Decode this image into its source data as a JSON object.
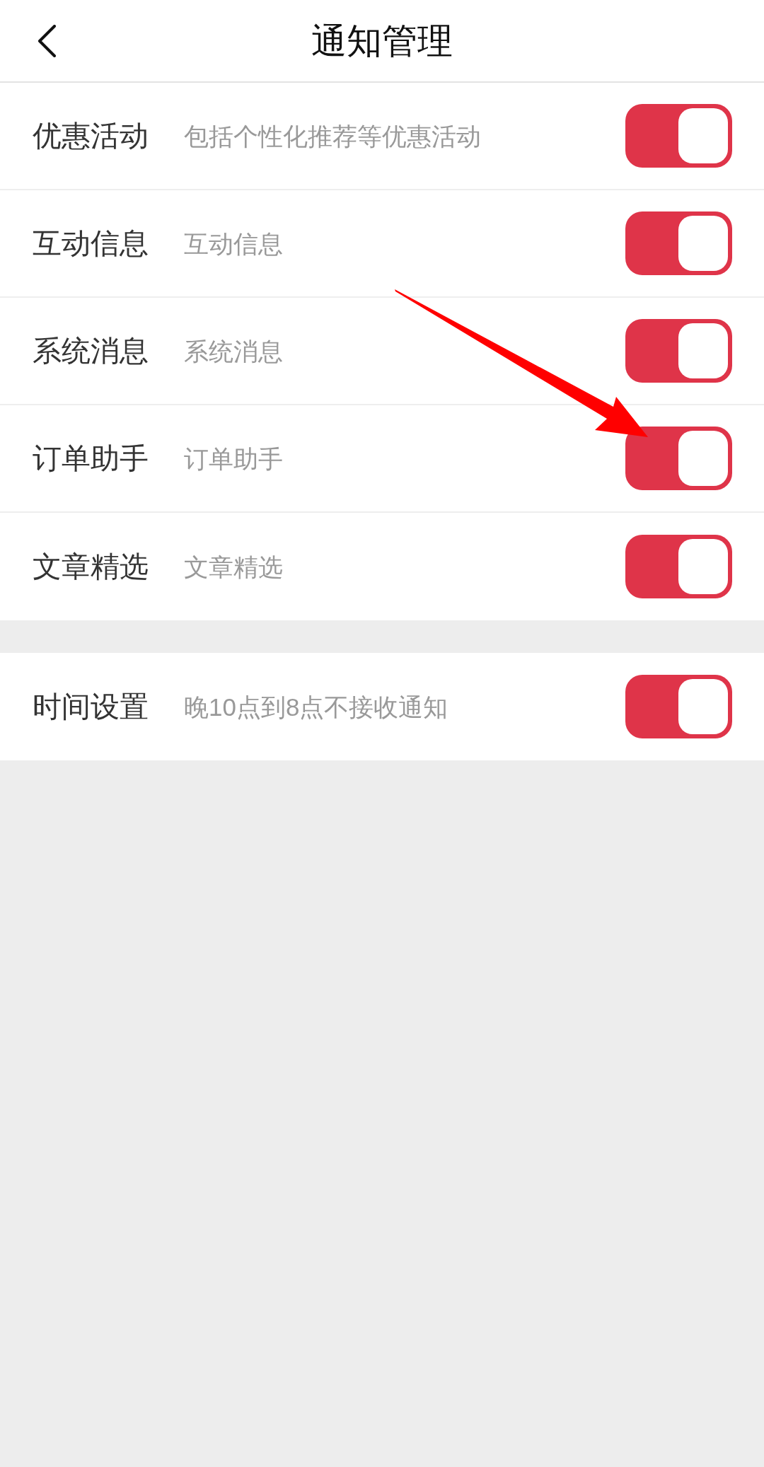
{
  "header": {
    "title": "通知管理"
  },
  "sections": [
    {
      "rows": [
        {
          "label": "优惠活动",
          "description": "包括个性化推荐等优惠活动",
          "on": true
        },
        {
          "label": "互动信息",
          "description": "互动信息",
          "on": true
        },
        {
          "label": "系统消息",
          "description": "系统消息",
          "on": true
        },
        {
          "label": "订单助手",
          "description": "订单助手",
          "on": true
        },
        {
          "label": "文章精选",
          "description": "文章精选",
          "on": true
        }
      ]
    },
    {
      "rows": [
        {
          "label": "时间设置",
          "description": "晚10点到8点不接收通知",
          "on": true
        }
      ]
    }
  ]
}
